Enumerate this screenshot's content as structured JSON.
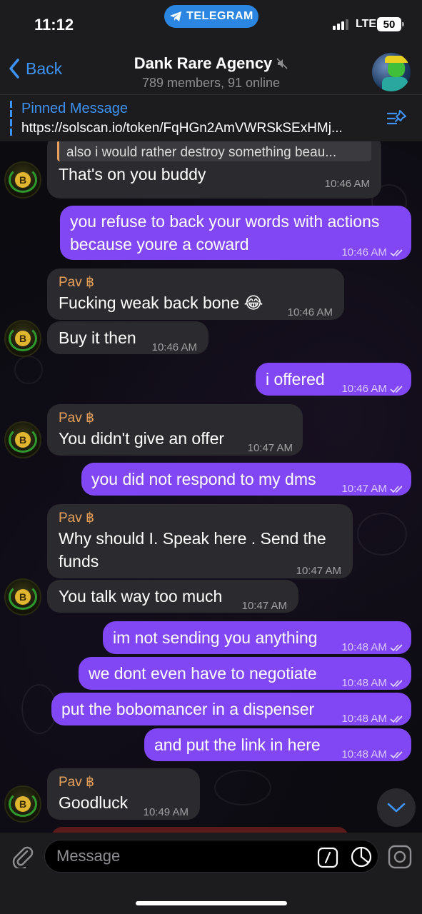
{
  "status_bar": {
    "time": "11:12",
    "app_pill": "TELEGRAM",
    "network": "LTE",
    "battery": "50"
  },
  "header": {
    "back_label": "Back",
    "title": "Dank Rare Agency",
    "subtitle": "789 members, 91 online"
  },
  "pinned": {
    "label": "Pinned Message",
    "text": "https://solscan.io/token/FqHGn2AmVWRSkSExHMj..."
  },
  "messages": [
    {
      "dir": "in",
      "quote": "also i would rather destroy something beau...",
      "text": "That's on you buddy",
      "time": "10:46 AM"
    },
    {
      "dir": "out",
      "text": "you refuse to back your words with actions because youre a coward",
      "time": "10:46 AM"
    },
    {
      "dir": "in",
      "sender": "Pav ฿",
      "text": "Fucking weak back bone 😂",
      "time": "10:46 AM"
    },
    {
      "dir": "in",
      "text": "Buy it then",
      "time": "10:46 AM"
    },
    {
      "dir": "out",
      "text": "i offered",
      "time": "10:46 AM"
    },
    {
      "dir": "in",
      "sender": "Pav ฿",
      "text": "You didn't give an offer",
      "time": "10:47 AM"
    },
    {
      "dir": "out",
      "text": "you did not respond to my dms",
      "time": "10:47 AM"
    },
    {
      "dir": "in",
      "sender": "Pav ฿",
      "text": "Why should I.  Speak here . Send the funds",
      "time": "10:47 AM"
    },
    {
      "dir": "in",
      "text": "You talk way too much",
      "time": "10:47 AM"
    },
    {
      "dir": "out",
      "text": "im not sending you anything",
      "time": "10:48 AM"
    },
    {
      "dir": "out",
      "text": "we dont even have to negotiate",
      "time": "10:48 AM"
    },
    {
      "dir": "out",
      "text": "put the bobomancer in a dispenser",
      "time": "10:48 AM"
    },
    {
      "dir": "out",
      "text": "and put the link in here",
      "time": "10:48 AM"
    },
    {
      "dir": "in",
      "sender": "Pav ฿",
      "text": "Goodluck",
      "time": "10:49 AM"
    }
  ],
  "composer": {
    "placeholder": "Message"
  },
  "colors": {
    "accent": "#3d93f5",
    "outgoing": "#8247f5",
    "incoming": "#2b2b2f",
    "sender_name": "#e8a15a"
  },
  "icons": [
    "telegram-icon",
    "back-chevron-icon",
    "mute-icon",
    "pin-list-icon",
    "read-checks-icon",
    "chevron-down-icon",
    "paperclip-icon",
    "command-icon",
    "sticker-icon",
    "camera-icon"
  ]
}
